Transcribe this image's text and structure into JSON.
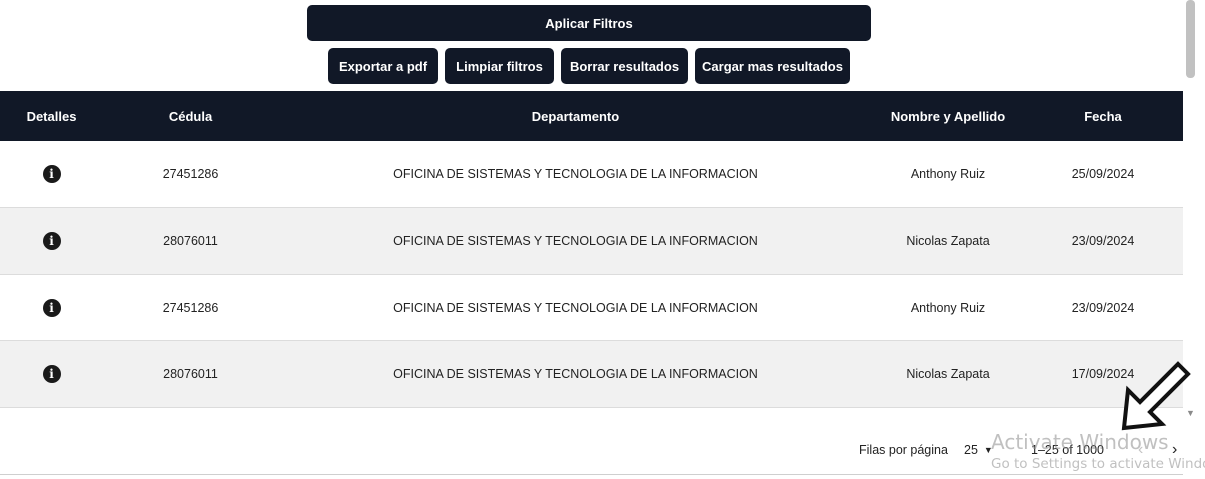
{
  "buttons": {
    "apply": "Aplicar Filtros",
    "export": "Exportar a pdf",
    "clear": "Limpiar filtros",
    "delete": "Borrar resultados",
    "load": "Cargar mas resultados"
  },
  "table": {
    "headers": [
      "Detalles",
      "Cédula",
      "Departamento",
      "Nombre y Apellido",
      "Fecha"
    ],
    "rows": [
      {
        "cedula": "27451286",
        "departamento": "OFICINA DE SISTEMAS Y TECNOLOGIA DE LA INFORMACION",
        "nombre": "Anthony Ruiz",
        "fecha": "25/09/2024"
      },
      {
        "cedula": "28076011",
        "departamento": "OFICINA DE SISTEMAS Y TECNOLOGIA DE LA INFORMACION",
        "nombre": "Nicolas Zapata",
        "fecha": "23/09/2024"
      },
      {
        "cedula": "27451286",
        "departamento": "OFICINA DE SISTEMAS Y TECNOLOGIA DE LA INFORMACION",
        "nombre": "Anthony Ruiz",
        "fecha": "23/09/2024"
      },
      {
        "cedula": "28076011",
        "departamento": "OFICINA DE SISTEMAS Y TECNOLOGIA DE LA INFORMACION",
        "nombre": "Nicolas Zapata",
        "fecha": "17/09/2024"
      }
    ],
    "detail_icon": "info-icon"
  },
  "pagination": {
    "rows_label": "Filas por página",
    "rows_per_page": "25",
    "range": "1–25 of 1000",
    "prev_icon": "chevron-left-icon",
    "next_icon": "chevron-right-icon"
  },
  "watermark": {
    "line1": "Activate Windows",
    "line2": "Go to Settings to activate Windo"
  }
}
